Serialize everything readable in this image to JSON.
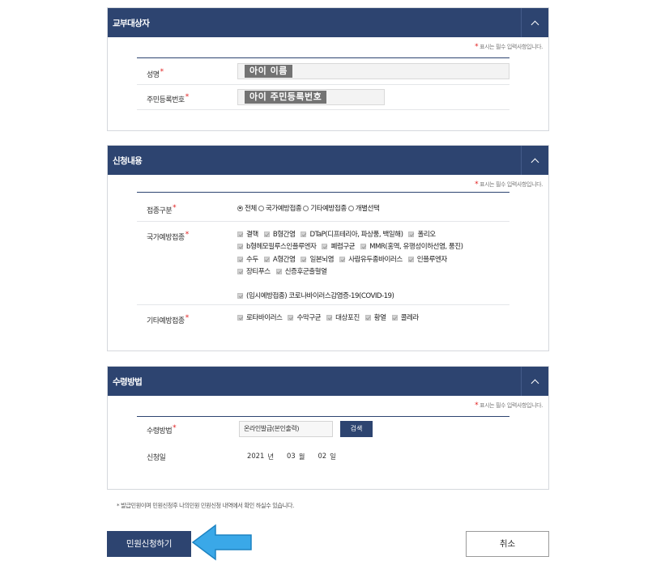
{
  "required_note": "표시는 필수 입력사항입니다.",
  "required_mark": "*",
  "recipient": {
    "title": "교부대상자",
    "name_label": "성명",
    "name_value": "아이 이름",
    "rrn_label": "주민등록번호",
    "rrn_value": "아이 주민등록번호"
  },
  "application": {
    "title": "신청내용",
    "type_label": "접종구분",
    "type_options": [
      "전체",
      "국가예방접종",
      "기타예방접종",
      "개별선택"
    ],
    "type_selected": "전체",
    "national_label": "국가예방접종",
    "national_rows": [
      [
        "결핵",
        "B형간염",
        "DTaP(디프테리아, 파상풍, 백일해)",
        "폴리오"
      ],
      [
        "b형헤모필루스인플루엔자",
        "폐렴구균",
        "MMR(홍역, 유행성이하선염, 풍진)"
      ],
      [
        "수두",
        "A형간염",
        "일본뇌염",
        "사람유두종바이러스",
        "인플루엔자"
      ],
      [
        "장티푸스",
        "신증후군출혈열"
      ]
    ],
    "covid_item": "(임시예방접종) 코로나바이러스감염증-19(COVID-19)",
    "other_label": "기타예방접종",
    "other_items": [
      "로타바이러스",
      "수막구균",
      "대상포진",
      "황열",
      "콜레라"
    ]
  },
  "receipt": {
    "title": "수령방법",
    "method_label": "수령방법",
    "method_value": "온라인발급(본인출력)",
    "search_label": "검색",
    "date_label": "신청일",
    "year": "2021",
    "year_unit": "년",
    "month": "03",
    "month_unit": "월",
    "day": "02",
    "day_unit": "일"
  },
  "footnote": "* 발급민원이며 민원신청후 나의민원 민원신청 내역에서 확인 하실수 있습니다.",
  "submit_label": "민원신청하기",
  "cancel_label": "취소",
  "colors": {
    "header": "#2d4470",
    "required": "#e11d1d",
    "arrow": "#3aa8e8"
  },
  "icons": {
    "collapse": "chevron-up-icon",
    "pointer": "arrow-left-icon"
  }
}
